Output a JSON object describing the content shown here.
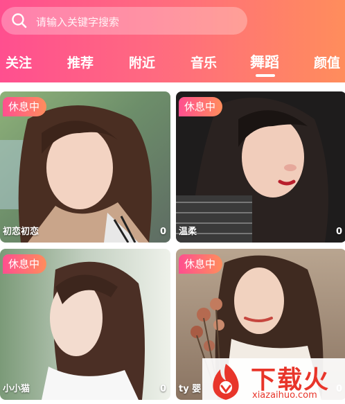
{
  "search": {
    "placeholder": "请输入关键字搜索"
  },
  "tabs": [
    {
      "label": "关注"
    },
    {
      "label": "推荐"
    },
    {
      "label": "附近"
    },
    {
      "label": "音乐"
    },
    {
      "label": "舞蹈",
      "active": true
    },
    {
      "label": "颜值"
    }
  ],
  "cards": [
    {
      "badge": "休息中",
      "name": "初恋初恋",
      "count": "0"
    },
    {
      "badge": "休息中",
      "name": "温柔",
      "count": "0"
    },
    {
      "badge": "休息中",
      "name": "小小猫",
      "count": "0"
    },
    {
      "badge": "休息中",
      "name": "ty 婴",
      "count": "0"
    }
  ],
  "watermark": {
    "title": "下载火",
    "url": "xiazaihuo.com"
  },
  "colors": {
    "header_start": "#ff4f8f",
    "header_end": "#ff8d5c",
    "badge_start": "#ff4f8f",
    "badge_end": "#ff8d5c",
    "watermark_red": "#e8352a"
  }
}
